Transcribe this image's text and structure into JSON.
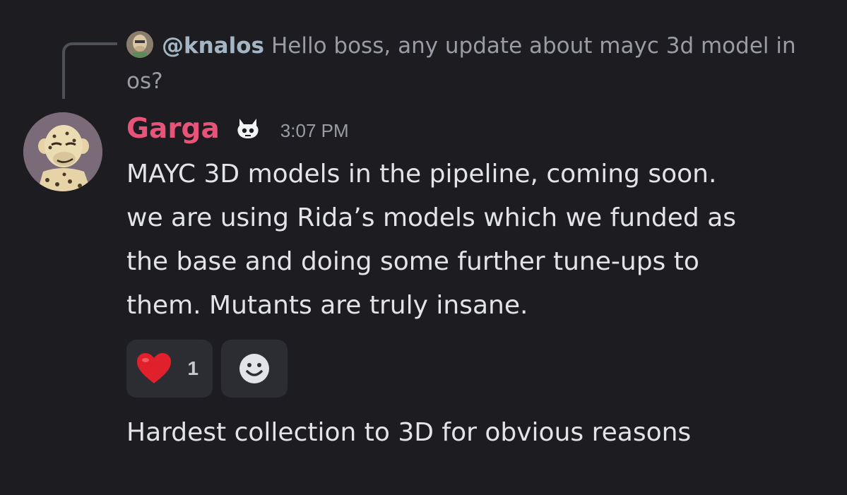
{
  "reply": {
    "author": "@knalos",
    "text": "Hello boss, any update about mayc 3d model in os?",
    "avatar_icon": "ape-avatar-icon"
  },
  "message": {
    "author": "Garga",
    "author_color": "#e8537a",
    "badge_icon": "robot-badge-icon",
    "timestamp": "3:07 PM",
    "body_lines": [
      "MAYC 3D models in the pipeline, coming soon.",
      "we are using Rida’s models which we funded as",
      "the base and doing some further tune-ups to",
      "them. Mutants are truly insane."
    ],
    "avatar_icon": "leopard-ape-avatar-icon"
  },
  "reactions": [
    {
      "emoji": "heart",
      "icon": "red-heart-icon",
      "count": "1"
    },
    {
      "icon": "add-reaction-smiley-icon"
    }
  ],
  "followup": {
    "text": "Hardest collection to 3D for obvious reasons"
  },
  "colors": {
    "background": "#1c1c21",
    "reply_author": "#a4b6c4",
    "muted_text": "#9a9ca3",
    "body_text": "#e3e4e8",
    "reaction_bg": "#2b2d33",
    "heart": "#e0202a"
  }
}
